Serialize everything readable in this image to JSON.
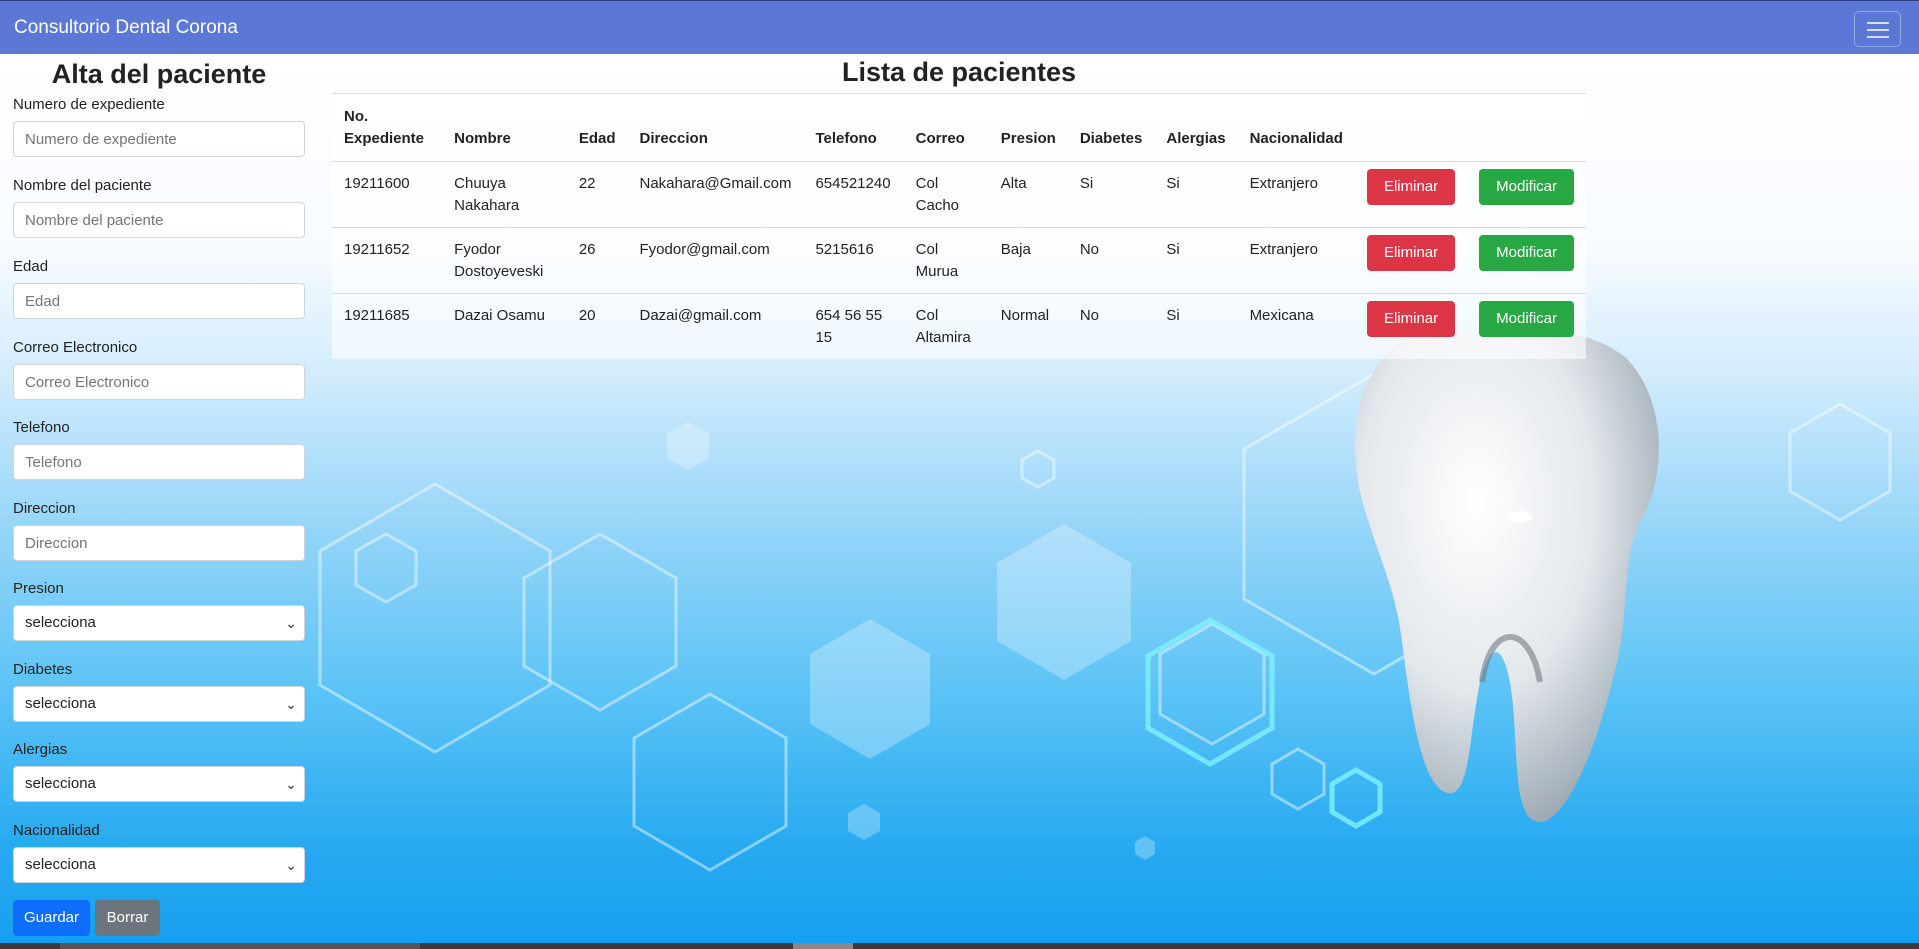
{
  "navbar": {
    "brand": "Consultorio Dental Corona",
    "toggle_icon": "hamburger-menu-icon"
  },
  "colors": {
    "navbar": "#5b78d6",
    "primary": "#0d6efd",
    "secondary": "#6c757d",
    "danger": "#dc3545",
    "success": "#28a745"
  },
  "form": {
    "title": "Alta del paciente",
    "fields": [
      {
        "label": "Numero de expediente",
        "placeholder": "Numero de expediente"
      },
      {
        "label": "Nombre del paciente",
        "placeholder": "Nombre del paciente"
      },
      {
        "label": "Edad",
        "placeholder": "Edad"
      },
      {
        "label": "Correo Electronico",
        "placeholder": "Correo Electronico"
      },
      {
        "label": "Telefono",
        "placeholder": "Telefono"
      },
      {
        "label": "Direccion",
        "placeholder": "Direccion"
      }
    ],
    "selects": [
      {
        "label": "Presion",
        "value": "selecciona"
      },
      {
        "label": "Diabetes",
        "value": "selecciona"
      },
      {
        "label": "Alergias",
        "value": "selecciona"
      },
      {
        "label": "Nacionalidad",
        "value": "selecciona"
      }
    ],
    "save_label": "Guardar",
    "clear_label": "Borrar"
  },
  "list": {
    "title": "Lista de pacientes",
    "headers": [
      "No. Expediente",
      "Nombre",
      "Edad",
      "Direccion",
      "Telefono",
      "Correo",
      "Presion",
      "Diabetes",
      "Alergias",
      "Nacionalidad"
    ],
    "delete_label": "Eliminar",
    "edit_label": "Modificar",
    "rows": [
      {
        "expediente": "19211600",
        "nombre": "Chuuya Nakahara",
        "edad": "22",
        "direccion": "Nakahara@Gmail.com",
        "telefono": "654521240",
        "correo": "Col Cacho",
        "presion": "Alta",
        "diabetes": "Si",
        "alergias": "Si",
        "nacionalidad": "Extranjero"
      },
      {
        "expediente": "19211652",
        "nombre": "Fyodor Dostoyeveski",
        "edad": "26",
        "direccion": "Fyodor@gmail.com",
        "telefono": "5215616",
        "correo": "Col Murua",
        "presion": "Baja",
        "diabetes": "No",
        "alergias": "Si",
        "nacionalidad": "Extranjero"
      },
      {
        "expediente": "19211685",
        "nombre": "Dazai Osamu",
        "edad": "20",
        "direccion": "Dazai@gmail.com",
        "telefono": "654 56 55 15",
        "correo": "Col Altamira",
        "presion": "Normal",
        "diabetes": "No",
        "alergias": "Si",
        "nacionalidad": "Mexicana"
      }
    ]
  },
  "background": {
    "illustration": "tooth-illustration",
    "pattern": "hexagon-pattern"
  }
}
